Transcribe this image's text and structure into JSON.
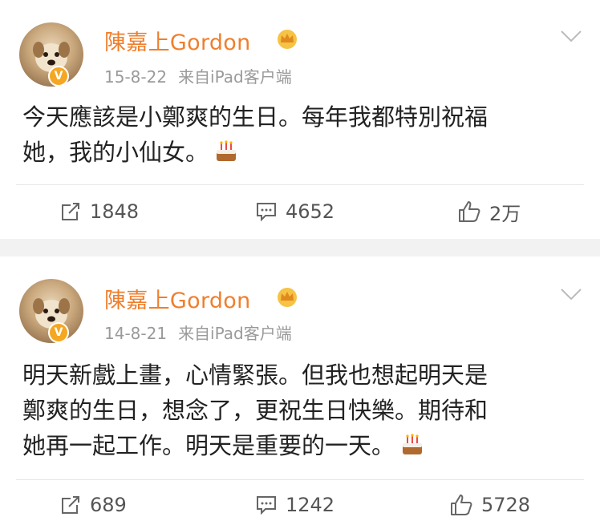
{
  "posts": [
    {
      "username": "陳嘉上Gordon",
      "date": "15-8-22",
      "source": "来自iPad客户端",
      "text_lines": [
        "今天應該是小鄭爽的生日。每年我都特別祝福",
        "她，我的小仙女。"
      ],
      "counts": {
        "repost": "1848",
        "comment": "4652",
        "like": "2万"
      }
    },
    {
      "username": "陳嘉上Gordon",
      "date": "14-8-21",
      "source": "来自iPad客户端",
      "text_lines": [
        "明天新戲上畫，心情緊張。但我也想起明天是",
        "鄭爽的生日，想念了，更祝生日快樂。期待和",
        "她再一起工作。明天是重要的一天。"
      ],
      "counts": {
        "repost": "689",
        "comment": "1242",
        "like": "5728"
      }
    }
  ],
  "icons": {
    "verified": "verified-v-icon",
    "crown": "crown-icon",
    "more": "chevron-down-icon",
    "repost": "repost-icon",
    "comment": "comment-icon",
    "like": "thumbs-up-icon",
    "emoji": "birthday-cake-emoji"
  },
  "colors": {
    "username": "#ef7f2d",
    "meta": "#9a9a9a",
    "verified": "#f5a623",
    "background": "#f2f2f2"
  }
}
